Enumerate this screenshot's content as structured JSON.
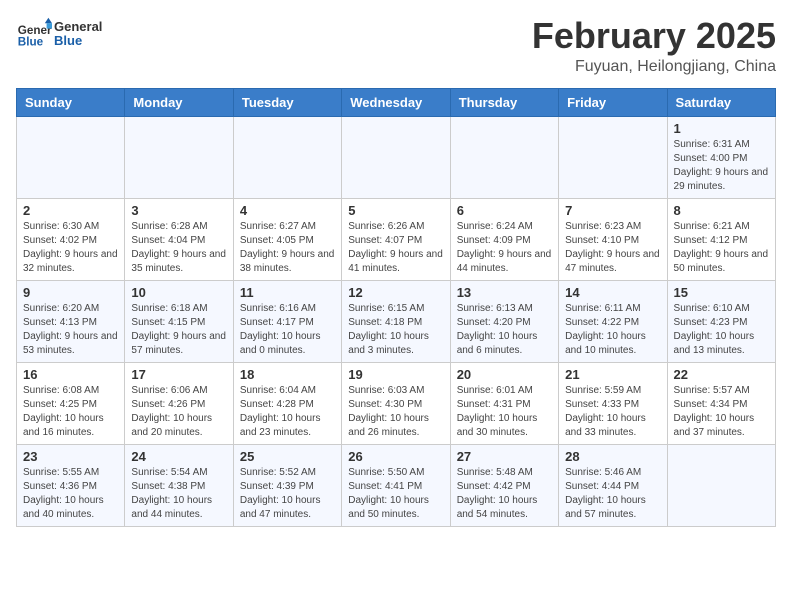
{
  "logo": {
    "general": "General",
    "blue": "Blue"
  },
  "title": "February 2025",
  "subtitle": "Fuyuan, Heilongjiang, China",
  "days_of_week": [
    "Sunday",
    "Monday",
    "Tuesday",
    "Wednesday",
    "Thursday",
    "Friday",
    "Saturday"
  ],
  "weeks": [
    [
      {
        "day": "",
        "info": ""
      },
      {
        "day": "",
        "info": ""
      },
      {
        "day": "",
        "info": ""
      },
      {
        "day": "",
        "info": ""
      },
      {
        "day": "",
        "info": ""
      },
      {
        "day": "",
        "info": ""
      },
      {
        "day": "1",
        "info": "Sunrise: 6:31 AM\nSunset: 4:00 PM\nDaylight: 9 hours and 29 minutes."
      }
    ],
    [
      {
        "day": "2",
        "info": "Sunrise: 6:30 AM\nSunset: 4:02 PM\nDaylight: 9 hours and 32 minutes."
      },
      {
        "day": "3",
        "info": "Sunrise: 6:28 AM\nSunset: 4:04 PM\nDaylight: 9 hours and 35 minutes."
      },
      {
        "day": "4",
        "info": "Sunrise: 6:27 AM\nSunset: 4:05 PM\nDaylight: 9 hours and 38 minutes."
      },
      {
        "day": "5",
        "info": "Sunrise: 6:26 AM\nSunset: 4:07 PM\nDaylight: 9 hours and 41 minutes."
      },
      {
        "day": "6",
        "info": "Sunrise: 6:24 AM\nSunset: 4:09 PM\nDaylight: 9 hours and 44 minutes."
      },
      {
        "day": "7",
        "info": "Sunrise: 6:23 AM\nSunset: 4:10 PM\nDaylight: 9 hours and 47 minutes."
      },
      {
        "day": "8",
        "info": "Sunrise: 6:21 AM\nSunset: 4:12 PM\nDaylight: 9 hours and 50 minutes."
      }
    ],
    [
      {
        "day": "9",
        "info": "Sunrise: 6:20 AM\nSunset: 4:13 PM\nDaylight: 9 hours and 53 minutes."
      },
      {
        "day": "10",
        "info": "Sunrise: 6:18 AM\nSunset: 4:15 PM\nDaylight: 9 hours and 57 minutes."
      },
      {
        "day": "11",
        "info": "Sunrise: 6:16 AM\nSunset: 4:17 PM\nDaylight: 10 hours and 0 minutes."
      },
      {
        "day": "12",
        "info": "Sunrise: 6:15 AM\nSunset: 4:18 PM\nDaylight: 10 hours and 3 minutes."
      },
      {
        "day": "13",
        "info": "Sunrise: 6:13 AM\nSunset: 4:20 PM\nDaylight: 10 hours and 6 minutes."
      },
      {
        "day": "14",
        "info": "Sunrise: 6:11 AM\nSunset: 4:22 PM\nDaylight: 10 hours and 10 minutes."
      },
      {
        "day": "15",
        "info": "Sunrise: 6:10 AM\nSunset: 4:23 PM\nDaylight: 10 hours and 13 minutes."
      }
    ],
    [
      {
        "day": "16",
        "info": "Sunrise: 6:08 AM\nSunset: 4:25 PM\nDaylight: 10 hours and 16 minutes."
      },
      {
        "day": "17",
        "info": "Sunrise: 6:06 AM\nSunset: 4:26 PM\nDaylight: 10 hours and 20 minutes."
      },
      {
        "day": "18",
        "info": "Sunrise: 6:04 AM\nSunset: 4:28 PM\nDaylight: 10 hours and 23 minutes."
      },
      {
        "day": "19",
        "info": "Sunrise: 6:03 AM\nSunset: 4:30 PM\nDaylight: 10 hours and 26 minutes."
      },
      {
        "day": "20",
        "info": "Sunrise: 6:01 AM\nSunset: 4:31 PM\nDaylight: 10 hours and 30 minutes."
      },
      {
        "day": "21",
        "info": "Sunrise: 5:59 AM\nSunset: 4:33 PM\nDaylight: 10 hours and 33 minutes."
      },
      {
        "day": "22",
        "info": "Sunrise: 5:57 AM\nSunset: 4:34 PM\nDaylight: 10 hours and 37 minutes."
      }
    ],
    [
      {
        "day": "23",
        "info": "Sunrise: 5:55 AM\nSunset: 4:36 PM\nDaylight: 10 hours and 40 minutes."
      },
      {
        "day": "24",
        "info": "Sunrise: 5:54 AM\nSunset: 4:38 PM\nDaylight: 10 hours and 44 minutes."
      },
      {
        "day": "25",
        "info": "Sunrise: 5:52 AM\nSunset: 4:39 PM\nDaylight: 10 hours and 47 minutes."
      },
      {
        "day": "26",
        "info": "Sunrise: 5:50 AM\nSunset: 4:41 PM\nDaylight: 10 hours and 50 minutes."
      },
      {
        "day": "27",
        "info": "Sunrise: 5:48 AM\nSunset: 4:42 PM\nDaylight: 10 hours and 54 minutes."
      },
      {
        "day": "28",
        "info": "Sunrise: 5:46 AM\nSunset: 4:44 PM\nDaylight: 10 hours and 57 minutes."
      },
      {
        "day": "",
        "info": ""
      }
    ]
  ]
}
